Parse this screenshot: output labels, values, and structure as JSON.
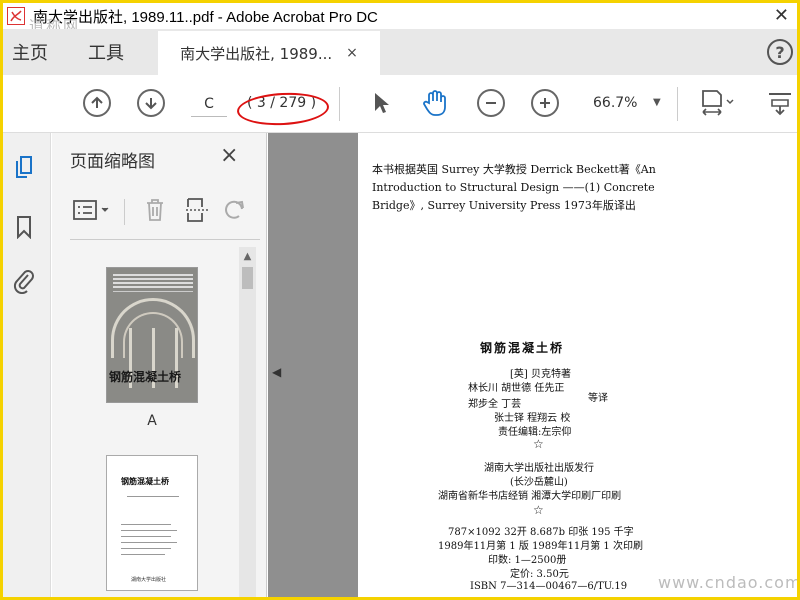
{
  "titlebar": {
    "title": "南大学出版社, 1989.11..pdf - Adobe Acrobat Pro DC",
    "close": "✕",
    "watermark": "道称网"
  },
  "tabs": {
    "home": "主页",
    "tools": "工具",
    "document": "南大学出版社, 1989...",
    "document_close": "×",
    "help": "?"
  },
  "toolbar": {
    "page_field_value": "C",
    "page_count": "( 3 / 279 )",
    "zoom": "66.7%"
  },
  "thumbnail_panel": {
    "title": "页面缩略图",
    "close": "×",
    "thumb1_label": "A",
    "thumb1_cover_title": "钢筋混凝土桥",
    "thumb2_title": "钢筋混凝土桥",
    "thumb2_footer": "湖南大学出版社"
  },
  "document": {
    "intro_line1": "本书根据英国  Surrey 大学教授  Derrick Beckett著《An",
    "intro_line2": "Introduction  to Structural  Design  ——(1) Concrete",
    "intro_line3": "Bridge》, Surrey University Press 1973年版译出",
    "book_title": "钢筋混凝土桥",
    "author": "[英]  贝克特著",
    "translators_line1": "林长川  胡世德  任先正",
    "translators_suffix": "等译",
    "translators_line2": "郑步全  丁芸",
    "proofreaders": "张士铎  程翔云  校",
    "editor": "责任编辑:左宗仰",
    "star": "☆",
    "publisher": "湖南大学出版社出版发行",
    "address": "(长沙岳麓山)",
    "distribution": "湖南省新华书店经销    湘潭大学印刷厂印刷",
    "spec": "787×1092  32开  8.687b 印张 195 千字",
    "edition": "1989年11月第 1 版      1989年11月第 1 次印刷",
    "print_run": "印数:     1—2500册",
    "price": "定价: 3.50元",
    "isbn": "ISBN  7—314—00467—6/TU.19",
    "watermark": "www.cndao.com"
  }
}
